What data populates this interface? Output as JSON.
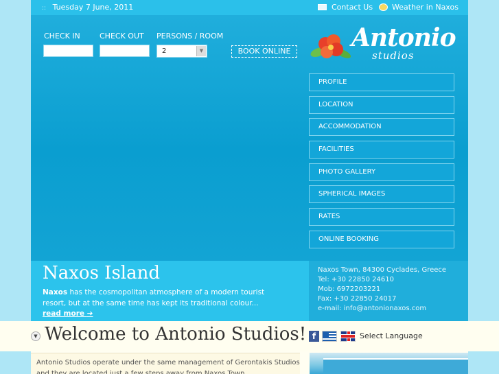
{
  "topbar": {
    "date": "Tuesday 7 June, 2011",
    "contact_label": "Contact Us",
    "weather_label": "Weather in Naxos"
  },
  "booking": {
    "checkin_label": "CHECK IN",
    "checkout_label": "CHECK OUT",
    "persons_label": "PERSONS / ROOM",
    "persons_value": "2",
    "book_label": "BOOK ONLINE"
  },
  "logo": {
    "name": "Antonio",
    "sub": "studios"
  },
  "nav": {
    "items": [
      {
        "label": "PROFILE"
      },
      {
        "label": "LOCATION"
      },
      {
        "label": "ACCOMMODATION"
      },
      {
        "label": "FACILITIES"
      },
      {
        "label": "PHOTO GALLERY"
      },
      {
        "label": "SPHERICAL IMAGES"
      },
      {
        "label": "RATES"
      },
      {
        "label": "ONLINE BOOKING"
      }
    ]
  },
  "info": {
    "title": "Naxos Island",
    "desc_bold": "Naxos",
    "desc_rest": " has the cosmopolitan atmosphere of a modern tourist resort, but at the same time has kept its traditional colour...",
    "more_label": "read more"
  },
  "contact": {
    "address": "Naxos Town, 84300 Cyclades, Greece",
    "tel": "Tel: +30 22850 24610",
    "mob": "Mob: 6972203221",
    "fax": "Fax: +30 22850 24017",
    "email": "e-mail: info@antonionaxos.com"
  },
  "welcome": {
    "heading": "Welcome to Antonio Studios!",
    "select_language": "Select Language",
    "facebook_letter": "f"
  },
  "content": {
    "text": "Antonio Studios operate under the same management of Gerontakis Studios and they are located just a few steps away from Naxos Town."
  }
}
